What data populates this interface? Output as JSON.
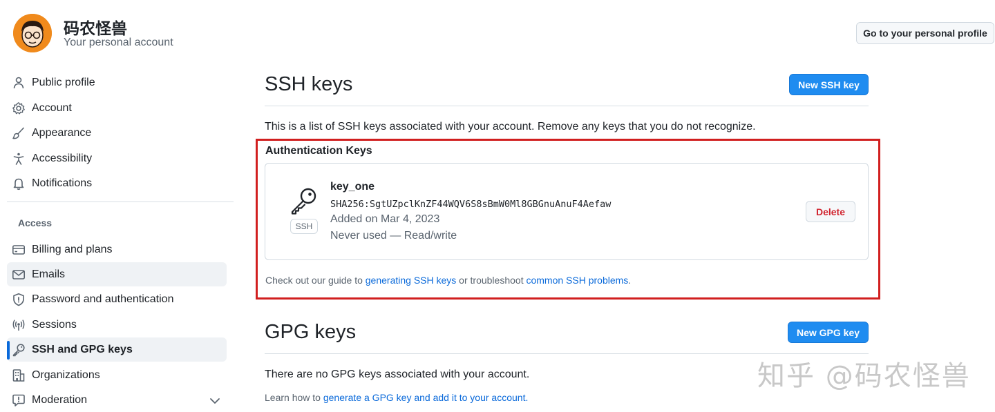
{
  "header": {
    "account_name": "码农怪兽",
    "account_subtitle": "Your personal account",
    "profile_button": "Go to your personal profile"
  },
  "sidebar": {
    "items_top": [
      {
        "label": "Public profile",
        "icon": "person-icon"
      },
      {
        "label": "Account",
        "icon": "gear-icon"
      },
      {
        "label": "Appearance",
        "icon": "paintbrush-icon"
      },
      {
        "label": "Accessibility",
        "icon": "accessibility-icon"
      },
      {
        "label": "Notifications",
        "icon": "bell-icon"
      }
    ],
    "access_heading": "Access",
    "items_access": [
      {
        "label": "Billing and plans",
        "icon": "credit-card-icon"
      },
      {
        "label": "Emails",
        "icon": "mail-icon"
      },
      {
        "label": "Password and authentication",
        "icon": "shield-icon"
      },
      {
        "label": "Sessions",
        "icon": "broadcast-icon"
      },
      {
        "label": "SSH and GPG keys",
        "icon": "key-icon",
        "selected": true
      },
      {
        "label": "Organizations",
        "icon": "organization-icon"
      },
      {
        "label": "Moderation",
        "icon": "report-icon"
      }
    ]
  },
  "ssh": {
    "title": "SSH keys",
    "new_button": "New SSH key",
    "description": "This is a list of SSH keys associated with your account. Remove any keys that you do not recognize.",
    "auth_heading": "Authentication Keys",
    "key": {
      "type_badge": "SSH",
      "name": "key_one",
      "fingerprint": "SHA256:SgtUZpclKnZF44WQV6S8sBmW0Ml8GBGnuAnuF4Aefaw",
      "added": "Added on Mar 4, 2023",
      "usage": "Never used — Read/write",
      "delete_button": "Delete"
    },
    "help": {
      "prefix": "Check out our guide to ",
      "link1": "generating SSH keys",
      "middle": " or troubleshoot ",
      "link2": "common SSH problems",
      "suffix": "."
    }
  },
  "gpg": {
    "title": "GPG keys",
    "new_button": "New GPG key",
    "empty_text": "There are no GPG keys associated with your account.",
    "help": {
      "prefix": "Learn how to ",
      "link": "generate a GPG key and add it to your account",
      "suffix": "."
    }
  },
  "watermark": "知乎 @码农怪兽",
  "colors": {
    "primary_button": "#1f8cf0",
    "highlight_frame": "#d11f1f",
    "link": "#0969da",
    "selected_bar": "#0969da"
  }
}
